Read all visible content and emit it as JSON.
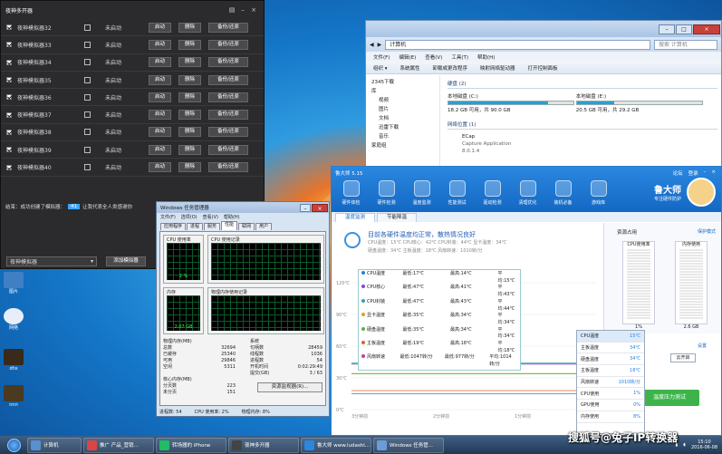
{
  "manager": {
    "title": "夜神多开器",
    "rows": [
      {
        "name": "夜神模拟器32",
        "status": "未启动"
      },
      {
        "name": "夜神模拟器33",
        "status": "未启动"
      },
      {
        "name": "夜神模拟器34",
        "status": "未启动"
      },
      {
        "name": "夜神模拟器35",
        "status": "未启动"
      },
      {
        "name": "夜神模拟器36",
        "status": "未启动"
      },
      {
        "name": "夜神模拟器37",
        "status": "未启动"
      },
      {
        "name": "夜神模拟器38",
        "status": "未启动"
      },
      {
        "name": "夜神模拟器39",
        "status": "未启动"
      },
      {
        "name": "夜神模拟器40",
        "status": "未启动"
      }
    ],
    "start_label": "启动",
    "delete_label": "删除",
    "backup_label": "备份/还原",
    "footer_prefix": "结束：成功创建了模拟器：",
    "footer_count": "41",
    "footer_suffix": "让我代表全人类感谢你",
    "select_value": "夜神模拟器",
    "add_label": "添加模拟器"
  },
  "explorer": {
    "address": "计算机",
    "search_placeholder": "搜索 计算机",
    "menu": [
      "文件(F)",
      "编辑(E)",
      "查看(V)",
      "工具(T)",
      "帮助(H)"
    ],
    "toolbar": [
      "组织 ▾",
      "系统属性",
      "卸载或更改程序",
      "映射网络驱动器",
      "打开控制面板"
    ],
    "nav": [
      "2345下载",
      "库",
      "视频",
      "图片",
      "文档",
      "迅雷下载",
      "音乐",
      "家庭组"
    ],
    "hdd_group": "硬盘 (2)",
    "drives": [
      {
        "name": "本地磁盘 (C:)",
        "free": "18.2 GB 可用，共 90.0 GB",
        "used": 0.8
      },
      {
        "name": "本地磁盘 (E:)",
        "free": "20.5 GB 可用，共 29.2 GB",
        "used": 0.3
      }
    ],
    "net_group": "网络位置 (1)",
    "net_name": "ECap",
    "net_desc": "Capture Application",
    "net_ver": "8.0.1.4"
  },
  "taskmgr": {
    "title": "Windows 任务管理器",
    "menu": [
      "文件(F)",
      "选项(O)",
      "查看(V)",
      "帮助(H)"
    ],
    "tabs": [
      "应用程序",
      "进程",
      "服务",
      "性能",
      "联网",
      "用户"
    ],
    "cpu_label": "CPU 使用率",
    "cpu_hist_label": "CPU 使用记录",
    "mem_label": "内存",
    "mem_hist_label": "物理内存使用记录",
    "cpu_value": "2 %",
    "mem_value": "2.07 GB",
    "phys": {
      "title": "物理内存(MB)",
      "rows": [
        [
          "总数",
          "32694"
        ],
        [
          "已缓存",
          "25340"
        ],
        [
          "可用",
          "29846"
        ],
        [
          "空闲",
          "5311"
        ]
      ]
    },
    "kern": {
      "title": "核心内存(MB)",
      "rows": [
        [
          "分页数",
          "223"
        ],
        [
          "未分页",
          "151"
        ]
      ]
    },
    "sys": {
      "title": "系统",
      "rows": [
        [
          "句柄数",
          "28459"
        ],
        [
          "线程数",
          "1036"
        ],
        [
          "进程数",
          "54"
        ],
        [
          "开机时间",
          "0:02:29:49"
        ],
        [
          "提交(GB)",
          "3 / 63"
        ]
      ]
    },
    "resmon": "资源监视器(R)...",
    "status": [
      "进程数: 54",
      "CPU 使用率: 2%",
      "物理内存: 8%"
    ]
  },
  "ludashi": {
    "version": "鲁大师 5.15",
    "top_links": [
      "论坛",
      "登录"
    ],
    "tools": [
      "硬件体检",
      "硬件检测",
      "温度监测",
      "性能测试",
      "驱动检测",
      "清理优化",
      "装机必备",
      "游戏库"
    ],
    "brand": "鲁大师",
    "slogan": "专注硬件防护",
    "tabs": [
      "温度监测",
      "节能降温"
    ],
    "headline": "目前各硬件温度均正常，散热情况良好",
    "temps1": "CPU温度：15℃  CPU核心：42℃  CPU封装：44℃  显卡温度：34℃",
    "temps2": "硬盘温度：34℃  主板温度：18℃  风扇转速：1010转/分",
    "legend": [
      {
        "n": "CPU温度",
        "min": "最低:17℃",
        "max": "最高:14℃",
        "avg": "平均:15℃",
        "color": "#2a7fd8"
      },
      {
        "n": "CPU核心",
        "min": "最低:47℃",
        "max": "最高:41℃",
        "avg": "平均:43℃",
        "color": "#7a4fc8"
      },
      {
        "n": "CPU封装",
        "min": "最低:47℃",
        "max": "最高:43℃",
        "avg": "平均:44℃",
        "color": "#3aa0a0"
      },
      {
        "n": "显卡温度",
        "min": "最低:35℃",
        "max": "最高:34℃",
        "avg": "平均:34℃",
        "color": "#e0a020"
      },
      {
        "n": "硬盘温度",
        "min": "最低:35℃",
        "max": "最高:34℃",
        "avg": "平均:34℃",
        "color": "#60b040"
      },
      {
        "n": "主板温度",
        "min": "最低:19℃",
        "max": "最高:18℃",
        "avg": "平均:18℃",
        "color": "#e06030"
      },
      {
        "n": "风扇转速",
        "min": "最低:1047转/分",
        "max": "最低:977转/分",
        "avg": "平均:1014转/分",
        "color": "#c040a0"
      }
    ],
    "y_ticks": [
      "120℃",
      "90℃",
      "60℃",
      "30℃",
      "0℃"
    ],
    "x_ticks": [
      "3分钟前",
      "2分钟前",
      "1分钟前",
      "当前"
    ],
    "res_title": "资源占用",
    "res_link": "保护模式",
    "cpu_gauge_label": "CPU使用率",
    "cpu_gauge_value": "1%",
    "mem_gauge_label": "内存使用",
    "mem_gauge_value": "2.6 GB",
    "monitor": [
      {
        "k": "CPU温度",
        "v": "15℃"
      },
      {
        "k": "主板温度",
        "v": "34℃"
      },
      {
        "k": "硬盘温度",
        "v": "34℃"
      },
      {
        "k": "主板温度",
        "v": "18℃"
      },
      {
        "k": "风扇转速",
        "v": "1010转/分"
      },
      {
        "k": "CPU使用",
        "v": "1%"
      },
      {
        "k": "GPU使用",
        "v": "0%"
      },
      {
        "k": "内存使用",
        "v": "8%"
      }
    ],
    "settings": "设置",
    "cloud": "云开启",
    "press_test": "温度压力测试"
  },
  "desktop_icons": [
    "图片",
    "网络",
    "夜神多开器",
    "dhs",
    "nnn"
  ],
  "taskbar": {
    "items": [
      "计算机",
      "推广 产品_营销...",
      "转场器的 iPhone",
      "夜神多开器",
      "鲁大师 www.ludashi...",
      "Windows 任务管..."
    ],
    "time": "15:10",
    "date": "2016-06-08"
  },
  "watermark": "搜狐号@兔子IP转换器"
}
